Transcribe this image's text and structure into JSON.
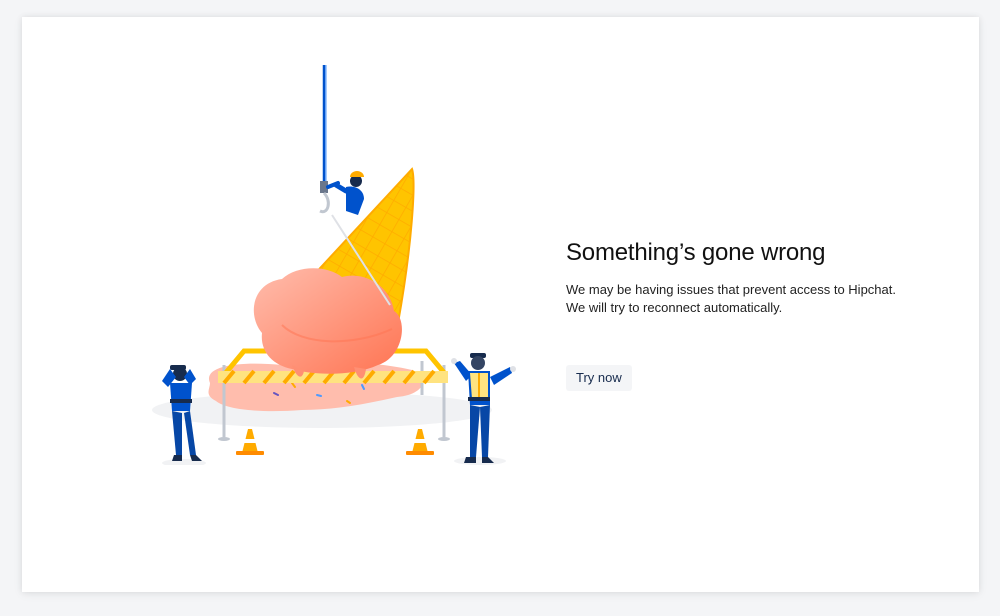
{
  "error": {
    "title": "Something’s gone wrong",
    "line1": "We may be having issues that prevent access to Hipchat.",
    "line2": "We will try to reconnect automatically.",
    "retry_label": "Try now"
  },
  "illustration": {
    "icon": "melted-ice-cream-illustration",
    "colors": {
      "cone": "#FFC400",
      "ice_cream": "#FF8F73",
      "uniform": "#0052CC",
      "barrier": "#FFAB00",
      "vest": "#FFE380"
    }
  }
}
